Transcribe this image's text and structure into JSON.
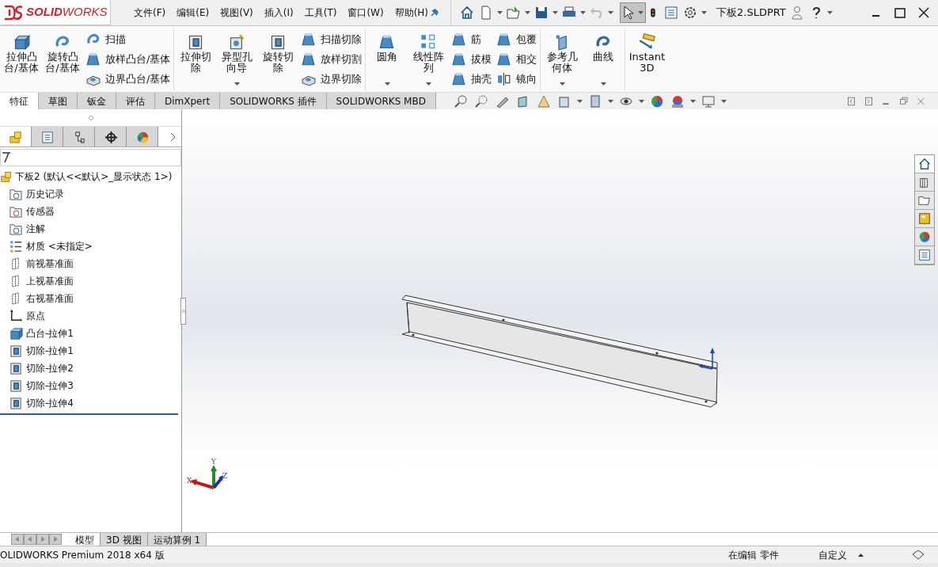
{
  "logo": "**SOLID**WORKS",
  "menus": [
    "文件(F)",
    "编辑(E)",
    "视图(V)",
    "插入(I)",
    "工具(T)",
    "窗口(W)",
    "帮助(H)"
  ],
  "document_title": "下板2.SLDPRT",
  "ribbon": [
    {
      "items": [
        {
          "kind": "large",
          "label": "拉伸凸台/基体",
          "dropdown": false
        },
        {
          "kind": "large",
          "label": "旋转凸台/基体",
          "dropdown": false
        },
        {
          "kind": "column",
          "items": [
            "扫描",
            "放样凸台/基体",
            "边界凸台/基体"
          ]
        }
      ]
    },
    {
      "items": [
        {
          "kind": "large",
          "label": "拉伸切除",
          "dropdown": false
        },
        {
          "kind": "large",
          "label": "异型孔向导",
          "dropdown": true
        },
        {
          "kind": "large",
          "label": "旋转切除",
          "dropdown": false
        },
        {
          "kind": "column",
          "items": [
            "扫描切除",
            "放样切割",
            "边界切除"
          ]
        }
      ]
    },
    {
      "items": [
        {
          "kind": "large",
          "label": "圆角",
          "dropdown": true
        },
        {
          "kind": "large",
          "label": "线性阵列",
          "dropdown": true
        },
        {
          "kind": "column",
          "items": [
            "筋",
            "拔模",
            "抽壳"
          ]
        },
        {
          "kind": "column",
          "items": [
            "包覆",
            "相交",
            "镜向"
          ]
        }
      ]
    },
    {
      "items": [
        {
          "kind": "large",
          "label": "参考几何体",
          "dropdown": true
        },
        {
          "kind": "large",
          "label": "曲线",
          "dropdown": true
        }
      ]
    },
    {
      "items": [
        {
          "kind": "large",
          "label": "Instant3D",
          "dropdown": false
        }
      ]
    }
  ],
  "command_tabs": [
    {
      "label": "特征",
      "selected": true
    },
    {
      "label": "草图",
      "selected": false
    },
    {
      "label": "钣金",
      "selected": false
    },
    {
      "label": "评估",
      "selected": false
    },
    {
      "label": "DimXpert",
      "selected": false
    },
    {
      "label": "SOLIDWORKS 插件",
      "selected": false
    },
    {
      "label": "SOLIDWORKS MBD",
      "selected": false
    }
  ],
  "panel_tabs": [
    {
      "selected": true
    },
    {
      "selected": false
    },
    {
      "selected": false
    },
    {
      "selected": false
    },
    {
      "selected": false
    }
  ],
  "tree": {
    "kind": "part",
    "label": "下板2 (默认<<默认>_显示状态 1>)",
    "children": [
      {
        "kind": "history",
        "label": "历史记录"
      },
      {
        "kind": "sensor",
        "label": "传感器"
      },
      {
        "kind": "annotation",
        "label": "注解"
      },
      {
        "kind": "material",
        "label": "材质 <未指定>"
      },
      {
        "kind": "plane",
        "label": "前视基准面"
      },
      {
        "kind": "plane",
        "label": "上视基准面"
      },
      {
        "kind": "plane",
        "label": "右视基准面"
      },
      {
        "kind": "origin",
        "label": "原点"
      },
      {
        "kind": "boss",
        "label": "凸台-拉伸1"
      },
      {
        "kind": "cut",
        "label": "切除-拉伸1"
      },
      {
        "kind": "cut",
        "label": "切除-拉伸2"
      },
      {
        "kind": "cut",
        "label": "切除-拉伸3"
      },
      {
        "kind": "cut",
        "label": "切除-拉伸4"
      }
    ]
  },
  "triad": {
    "x": "X",
    "y": "Y",
    "z": "Z"
  },
  "bottom_tabs": [
    {
      "label": "模型",
      "selected": true
    },
    {
      "label": "3D 视图",
      "selected": false
    },
    {
      "label": "运动算例 1",
      "selected": false
    }
  ],
  "status_bar": {
    "product": "OLIDWORKS Premium 2018 x64 版",
    "mode": "在编辑 零件",
    "units": "自定义"
  }
}
